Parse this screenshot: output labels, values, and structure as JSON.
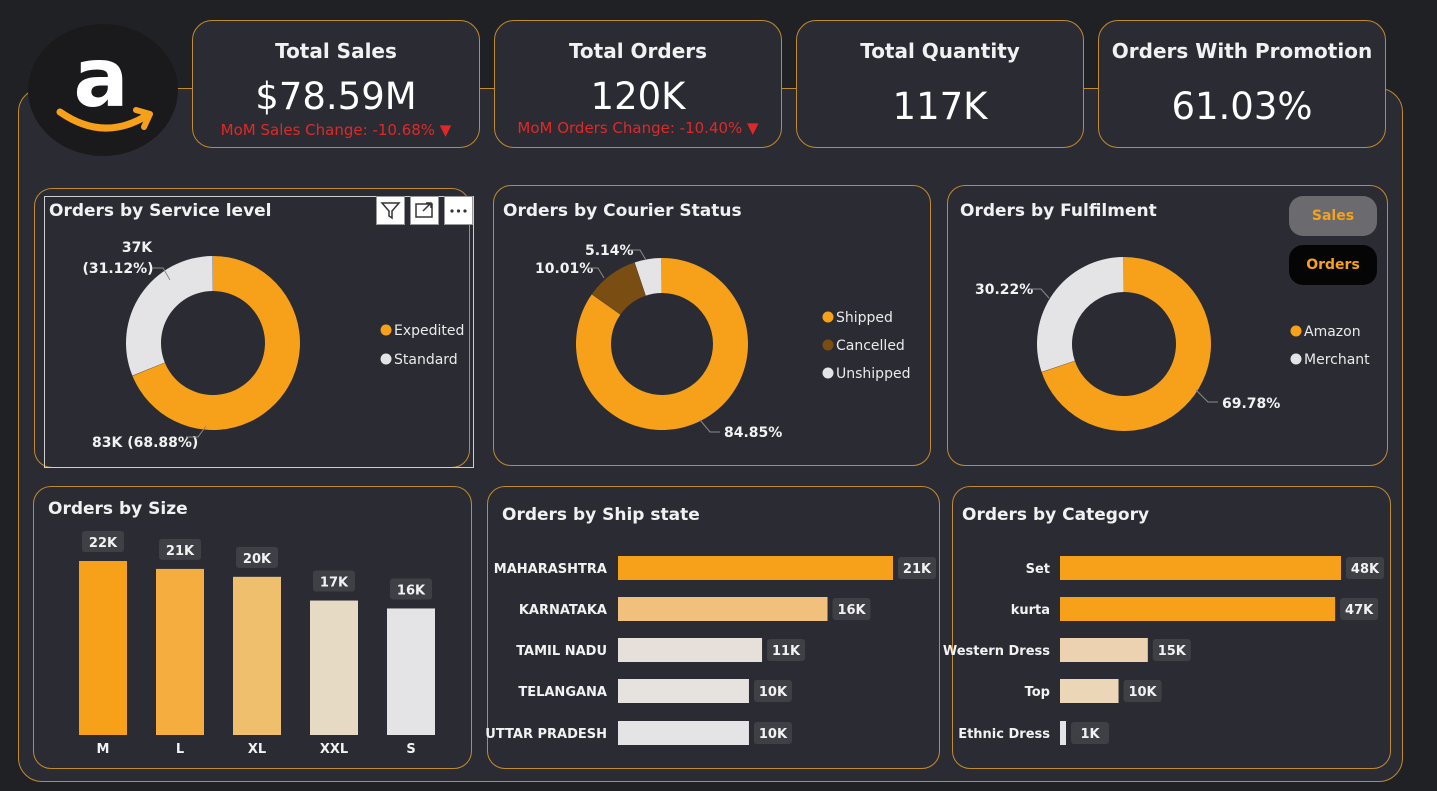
{
  "kpis": {
    "sales": {
      "title": "Total Sales",
      "value": "$78.59M",
      "change": "MoM Sales Change: -10.68% ▼"
    },
    "orders": {
      "title": "Total Orders",
      "value": "120K",
      "change": "MoM Orders Change: -10.40% ▼"
    },
    "quantity": {
      "title": "Total Quantity",
      "value": "117K"
    },
    "promotion": {
      "title": "Orders With Promotion",
      "value": "61.03%"
    }
  },
  "toggle": {
    "sales_label": "Sales",
    "orders_label": "Orders",
    "selected": "Orders"
  },
  "colors": {
    "orange": "#f7a11a",
    "light": "#e4e4e6",
    "brown": "#7a4e12",
    "frame": "#c08a2e",
    "panel": "#2b2c33"
  },
  "chart_data": [
    {
      "type": "pie",
      "title": "Orders by Service level",
      "slices": [
        {
          "label": "Expedited",
          "value": 68.88,
          "data_label": "83K (68.88%)",
          "color": "#f7a11a"
        },
        {
          "label": "Standard",
          "value": 31.12,
          "data_label_line1": "37K",
          "data_label_line2": "(31.12%)",
          "color": "#e4e4e6"
        }
      ],
      "legend_position": "right"
    },
    {
      "type": "pie",
      "title": "Orders by Courier Status",
      "slices": [
        {
          "label": "Shipped",
          "value": 84.85,
          "data_label": "84.85%",
          "color": "#f7a11a"
        },
        {
          "label": "Cancelled",
          "value": 10.01,
          "data_label": "10.01%",
          "color": "#7a4e12"
        },
        {
          "label": "Unshipped",
          "value": 5.14,
          "data_label": "5.14%",
          "color": "#e4e4e6"
        }
      ],
      "legend_position": "right"
    },
    {
      "type": "pie",
      "title": "Orders by Fulfilment",
      "slices": [
        {
          "label": "Amazon",
          "value": 69.78,
          "data_label": "69.78%",
          "color": "#f7a11a"
        },
        {
          "label": "Merchant",
          "value": 30.22,
          "data_label": "30.22%",
          "color": "#e4e4e6"
        }
      ],
      "legend_position": "right"
    },
    {
      "type": "bar",
      "title": "Orders by Size",
      "categories": [
        "M",
        "L",
        "XL",
        "XXL",
        "S"
      ],
      "values": [
        22,
        21,
        20,
        17,
        16
      ],
      "data_labels": [
        "22K",
        "21K",
        "20K",
        "17K",
        "16K"
      ],
      "colors": [
        "#f7a11a",
        "#f4ad3e",
        "#f0bf6e",
        "#e7dac5",
        "#e4e4e6"
      ],
      "unit": "K",
      "ylim": [
        0,
        24
      ]
    },
    {
      "type": "bar",
      "orientation": "horizontal",
      "title": "Orders by Ship state",
      "categories": [
        "MAHARASHTRA",
        "KARNATAKA",
        "TAMIL NADU",
        "TELANGANA",
        "UTTAR PRADESH"
      ],
      "values": [
        21,
        16,
        11,
        10,
        10
      ],
      "data_labels": [
        "21K",
        "16K",
        "11K",
        "10K",
        "10K"
      ],
      "colors": [
        "#f7a11a",
        "#f0c07c",
        "#e6dfda",
        "#e6e2de",
        "#e4e4e6"
      ],
      "xlim": [
        0,
        21
      ]
    },
    {
      "type": "bar",
      "orientation": "horizontal",
      "title": "Orders by Category",
      "categories": [
        "Set",
        "kurta",
        "Western Dress",
        "Top",
        "Ethnic Dress"
      ],
      "values": [
        48,
        47,
        15,
        10,
        1
      ],
      "data_labels": [
        "48K",
        "47K",
        "15K",
        "10K",
        "1K"
      ],
      "colors": [
        "#f7a11a",
        "#f7a11a",
        "#ecd2b1",
        "#ecd6b8",
        "#e4e4e6"
      ],
      "xlim": [
        0,
        48
      ]
    }
  ]
}
